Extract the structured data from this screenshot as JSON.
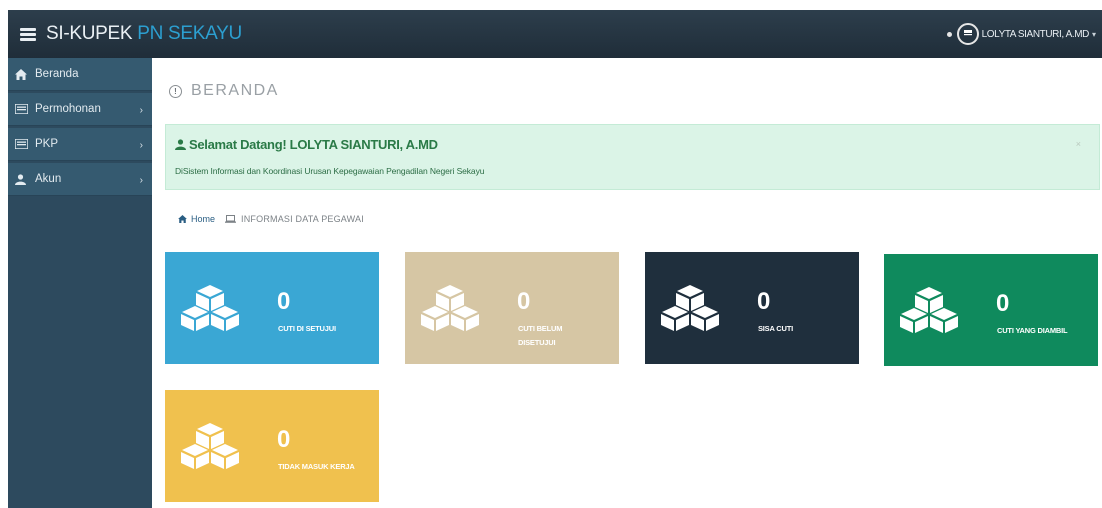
{
  "app": {
    "brand_part1": "SI-KUPEK",
    "brand_part2": "PN SEKAYU",
    "user_name": "LOLYTA SIANTURI, A.MD"
  },
  "sidebar": {
    "items": [
      {
        "label": "Beranda",
        "icon": "home-icon"
      },
      {
        "label": "Permohonan",
        "icon": "list-icon"
      },
      {
        "label": "PKP",
        "icon": "list-icon"
      },
      {
        "label": "Akun",
        "icon": "user-icon"
      }
    ]
  },
  "page": {
    "title": "BERANDA"
  },
  "welcome": {
    "title": "Selamat Datang! LOLYTA SIANTURI, A.MD",
    "subtitle": "DiSistem Informasi dan Koordinasi Urusan Kepegawaian Pengadilan Negeri Sekayu"
  },
  "breadcrumb": {
    "home": "Home",
    "current": "INFORMASI DATA PEGAWAI"
  },
  "cards": [
    {
      "value": "0",
      "label": "CUTI DI SETUJUI",
      "color": "#3aa7d4"
    },
    {
      "value": "0",
      "label": "CUTI BELUM DISETUJUI",
      "color": "#d6c6a4"
    },
    {
      "value": "0",
      "label": "SISA CUTI",
      "color": "#1f2f3d"
    },
    {
      "value": "0",
      "label": "CUTI YANG DIAMBIL",
      "color": "#0f8a5d"
    },
    {
      "value": "0",
      "label": "TIDAK MASUK KERJA",
      "color": "#f0c14e"
    }
  ]
}
